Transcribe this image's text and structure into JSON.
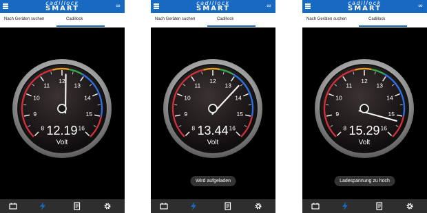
{
  "app": {
    "logo_line1": "cadillock",
    "logo_line2": "SMART"
  },
  "tabs": {
    "search": "Nach Geräten suchen",
    "device": "Cadillock"
  },
  "gauge": {
    "labels": [
      "8",
      "9",
      "10",
      "11",
      "12",
      "13",
      "14",
      "15",
      "16"
    ],
    "unit": "Volt"
  },
  "screens": [
    {
      "voltage_text": "12.19",
      "value": 12.19,
      "status_text": ""
    },
    {
      "voltage_text": "13.44",
      "value": 13.44,
      "status_text": "Wird aufgeladen"
    },
    {
      "voltage_text": "15.29",
      "value": 15.29,
      "status_text": "Ladespannung zu hoch"
    }
  ],
  "icons": [
    "menu-icon",
    "link-icon",
    "battery-icon",
    "bolt-icon",
    "log-icon",
    "settings-icon"
  ],
  "colors": {
    "topbar": "#1769c2",
    "red": "#d0303a",
    "green": "#34a84a",
    "blue": "#2d6fe0",
    "accent_active": "#1769c2"
  }
}
